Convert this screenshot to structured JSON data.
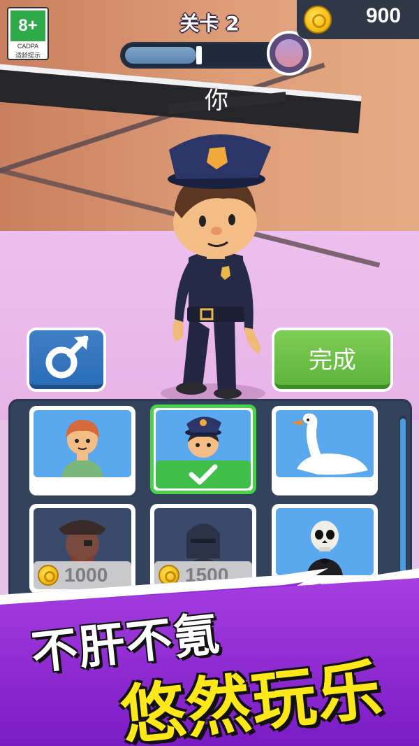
{
  "hud": {
    "age_rating": "8+",
    "age_org": "CADPA",
    "age_tip": "适龄提示",
    "level_label": "关卡 2",
    "level_progress": 0.45,
    "coins": "900"
  },
  "scene": {
    "player_label": "你"
  },
  "buttons": {
    "gender_icon": "male-symbol-icon",
    "done_label": "完成"
  },
  "skins": [
    {
      "name": "red-hair-boy",
      "state": "owned"
    },
    {
      "name": "police-officer",
      "state": "selected"
    },
    {
      "name": "goose",
      "state": "owned"
    },
    {
      "name": "pirate",
      "state": "locked",
      "price": "1000"
    },
    {
      "name": "knight",
      "state": "locked",
      "price": "1500"
    },
    {
      "name": "skeleton",
      "state": "owned"
    }
  ],
  "promo": {
    "line1": "不肝不氪",
    "line2": "悠然玩乐"
  },
  "colors": {
    "done_green": "#5db53b",
    "gender_blue": "#2a6db8",
    "panel_bg": "#34435c",
    "select_border": "#49d247",
    "promo_yellow": "#ffe81a",
    "promo_purple": "#8e2bd6"
  }
}
